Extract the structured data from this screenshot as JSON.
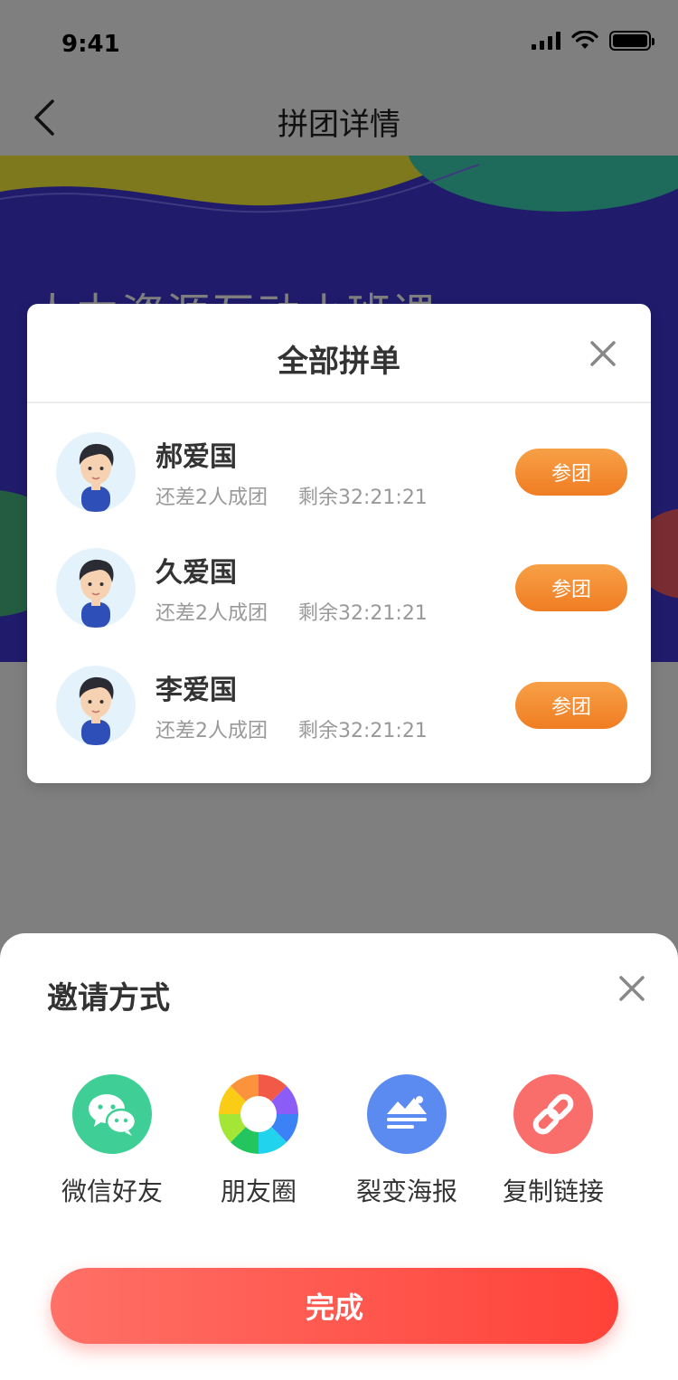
{
  "status_bar": {
    "time": "9:41"
  },
  "nav": {
    "title": "拼团详情"
  },
  "banner": {
    "title": "人力资源互动小班课"
  },
  "modal": {
    "title": "全部拼单",
    "items": [
      {
        "name": "郝爱国",
        "status": "还差2人成团",
        "remaining": "剩余32:21:21",
        "button": "参团"
      },
      {
        "name": "久爱国",
        "status": "还差2人成团",
        "remaining": "剩余32:21:21",
        "button": "参团"
      },
      {
        "name": "李爱国",
        "status": "还差2人成团",
        "remaining": "剩余32:21:21",
        "button": "参团"
      }
    ]
  },
  "sheet": {
    "title": "邀请方式",
    "options": [
      {
        "label": "微信好友",
        "icon": "wechat-icon",
        "color": "#3fcf96"
      },
      {
        "label": "朋友圈",
        "icon": "moments-icon",
        "color": "#ffffff"
      },
      {
        "label": "裂变海报",
        "icon": "poster-icon",
        "color": "#5b8af0"
      },
      {
        "label": "复制链接",
        "icon": "link-icon",
        "color": "#f96d6a"
      }
    ],
    "done": "完成"
  },
  "colors": {
    "accent_orange": "#f07d23",
    "accent_red": "#ff4a40",
    "banner_blue": "#4036d6",
    "overlay": "#808080"
  }
}
